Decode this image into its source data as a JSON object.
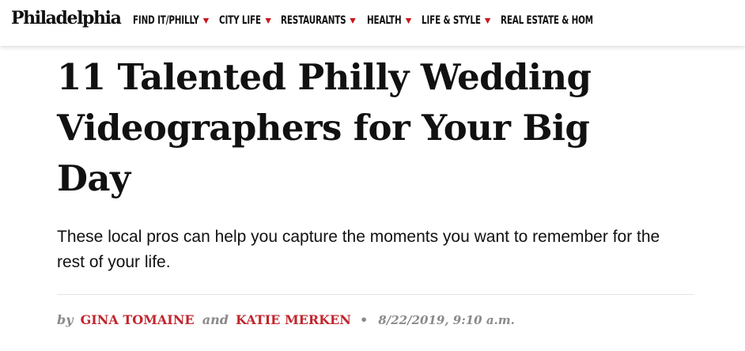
{
  "site": {
    "logo": "Philadelphia"
  },
  "nav": {
    "items": [
      {
        "label": "FIND IT/PHILLY",
        "has_dropdown": true
      },
      {
        "label": "CITY LIFE",
        "has_dropdown": true
      },
      {
        "label": "RESTAURANTS",
        "has_dropdown": true
      },
      {
        "label": "HEALTH",
        "has_dropdown": true
      },
      {
        "label": "LIFE & STYLE",
        "has_dropdown": true
      },
      {
        "label": "REAL ESTATE & HOM",
        "has_dropdown": false
      }
    ],
    "caret_color": "#c8161d"
  },
  "article": {
    "headline": "11 Talented Philly Wedding Videographers for Your Big Day",
    "dek": "These local pros can help you capture the moments you want to remember for the rest of your life.",
    "byline": {
      "by": "by",
      "author1": "GINA TOMAINE",
      "conjunction": "and",
      "author2": "KATIE MERKEN",
      "separator": "•",
      "timestamp": "8/22/2019, 9:10 a.m."
    }
  },
  "colors": {
    "accent_red": "#c0262d",
    "text": "#111111",
    "meta_gray": "#8a8a8a"
  }
}
